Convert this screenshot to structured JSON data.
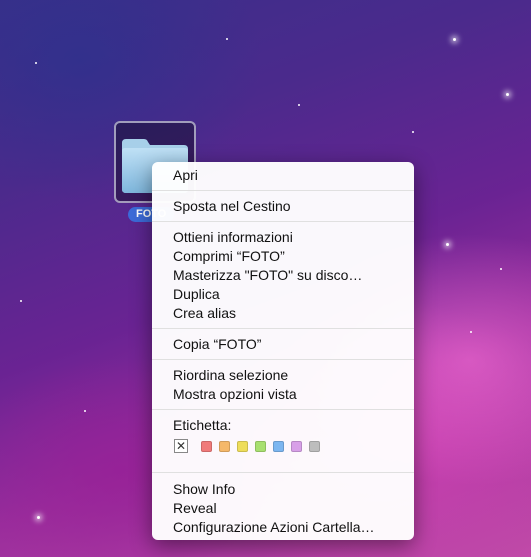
{
  "desktop": {
    "folder_label": "FOTO"
  },
  "menu": {
    "items": [
      {
        "label": "Apri"
      },
      {
        "label": "Sposta nel Cestino"
      },
      {
        "label": "Ottieni informazioni"
      },
      {
        "label": "Comprimi “FOTO”"
      },
      {
        "label": "Masterizza \"FOTO\" su disco…"
      },
      {
        "label": "Duplica"
      },
      {
        "label": "Crea alias"
      },
      {
        "label": "Copia “FOTO”"
      },
      {
        "label": "Riordina selezione"
      },
      {
        "label": "Mostra opzioni vista"
      },
      {
        "label": "Etichetta:"
      },
      {
        "label": "Show Info"
      },
      {
        "label": "Reveal"
      },
      {
        "label": "Configurazione Azioni Cartella…"
      }
    ],
    "label_none_glyph": "✕",
    "label_colors": [
      "#f07a7a",
      "#f5b86a",
      "#eedd5a",
      "#a8e070",
      "#7cb6f0",
      "#d8a0e8",
      "#bdbdbd"
    ]
  }
}
